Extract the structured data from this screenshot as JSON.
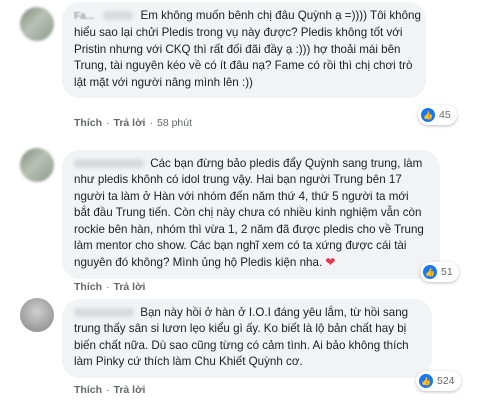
{
  "comments": [
    {
      "author": "Fa...",
      "lines": [
        "Em không muốn bênh chị đâu Quỳnh ạ =)))) Tôi không",
        "hiểu sao lại chửi Pledis trong vụ này được? Pledis không tốt với",
        "Pristin nhưng với CKQ thì rất đối đãi đầy ạ :))) hợ thoải mái bên",
        "Trung, tài nguyên kéo về có ít đâu nạ? Fame có rồi thì chị chơi trò",
        "lật mặt với người nâng mình lên :))"
      ],
      "like_label": "Thích",
      "reply_label": "Trả lời",
      "time": "58 phút",
      "reaction_count": "45",
      "reaction_icon": "like-icon"
    },
    {
      "lines": [
        "Các bạn đừng bảo pledis đẩy Quỳnh sang trung, làm",
        "như pledis khônh có idol trung vậy. Hai bạn người Trung bên 17",
        "người ta làm ở Hàn với nhóm đến năm thứ 4, thứ 5 người ta mới",
        "bắt đầu Trung tiến. Còn chị này chưa có nhiều kinh nghiệm vẫn còn",
        "rockie bên hàn, nhóm thì vừa 1, 2 năm đã được pledis cho về Trung",
        "làm mentor cho show. Các bạn nghĩ xem có ta xứng được cái tài",
        "nguyên đó không? Mình ủng hộ Pledis kiện nha."
      ],
      "emoji": "heart-emoji",
      "like_label": "Thích",
      "reply_label": "Trả lời",
      "reaction_count": "51",
      "reaction_icon": "like-icon"
    },
    {
      "lines": [
        "Bạn này hồi ở hàn ở I.O.I đáng yêu lắm, từ hồi sang",
        "trung thấy sân si lươn lẹo kiểu gì ấy. Ko biết là lộ bản chất hay bị",
        "biến chất nữa. Dù sao cũng từng có cảm tình. Ai bảo không thích",
        "làm Pinky cứ thích làm Chu Khiết Quỳnh cơ."
      ],
      "like_label": "Thích",
      "reply_label": "Trả lời",
      "reaction_count": "524",
      "reaction_icon": "like-icon"
    }
  ]
}
